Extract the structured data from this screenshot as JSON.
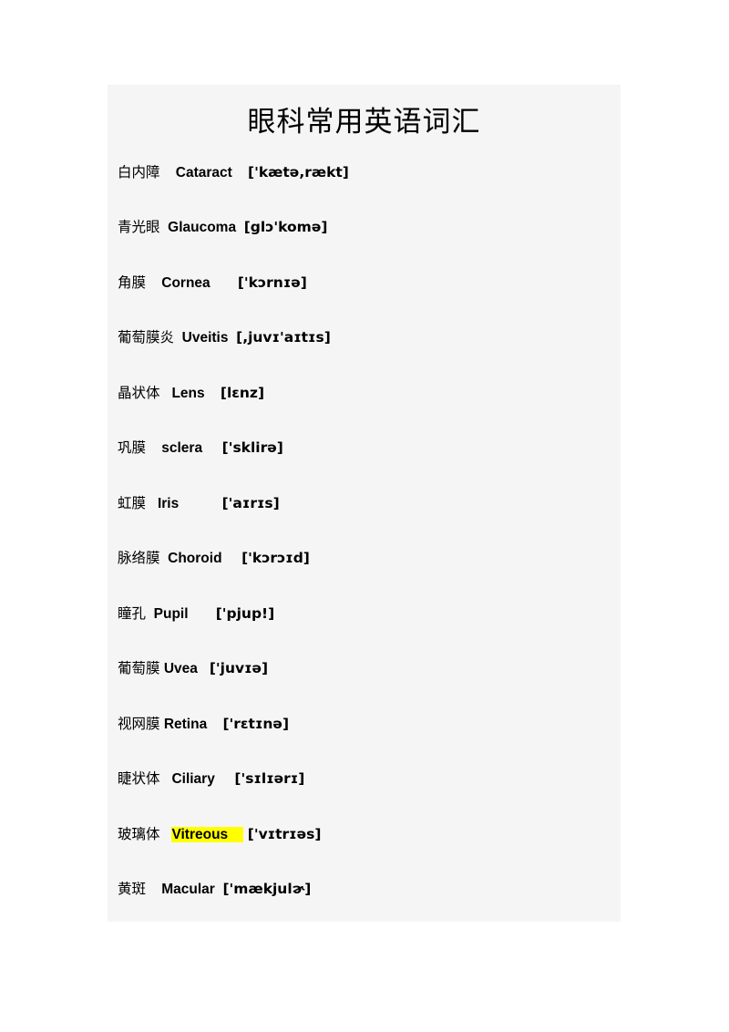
{
  "document": {
    "title": "眼科常用英语词汇",
    "background_color": "#f5f5f5",
    "page_color": "#ffffff",
    "highlight_color": "#ffff00",
    "text_color": "#000000"
  },
  "entries": [
    {
      "chinese": "白内障",
      "english": "Cataract",
      "ipa": "['kætə,rækt]",
      "highlighted": false,
      "gap1": "    ",
      "gap2": "    ",
      "highlight_pad": ""
    },
    {
      "chinese": "青光眼",
      "english": "Glaucoma",
      "ipa": "[glɔ'komə]",
      "highlighted": false,
      "gap1": "  ",
      "gap2": "  ",
      "highlight_pad": ""
    },
    {
      "chinese": "角膜",
      "english": "Cornea",
      "ipa": "['kɔrnɪə]",
      "highlighted": false,
      "gap1": "    ",
      "gap2": "       ",
      "highlight_pad": ""
    },
    {
      "chinese": "葡萄膜炎",
      "english": "Uveitis",
      "ipa": "[,juvɪ'aɪtɪs]",
      "highlighted": false,
      "gap1": "  ",
      "gap2": "  ",
      "highlight_pad": ""
    },
    {
      "chinese": "晶状体",
      "english": "Lens",
      "ipa": "[lɛnz]",
      "highlighted": false,
      "gap1": "   ",
      "gap2": "    ",
      "highlight_pad": ""
    },
    {
      "chinese": "巩膜",
      "english": "sclera",
      "ipa": "['sklirə]",
      "highlighted": false,
      "gap1": "    ",
      "gap2": "     ",
      "highlight_pad": ""
    },
    {
      "chinese": "虹膜",
      "english": "Iris",
      "ipa": "['aɪrɪs]",
      "highlighted": false,
      "gap1": "   ",
      "gap2": "           ",
      "highlight_pad": ""
    },
    {
      "chinese": "脉络膜",
      "english": "Choroid",
      "ipa": "['kɔrɔɪd]",
      "highlighted": false,
      "gap1": "  ",
      "gap2": "     ",
      "highlight_pad": ""
    },
    {
      "chinese": "瞳孔",
      "english": "Pupil",
      "ipa": "['pjup!]",
      "highlighted": false,
      "gap1": "  ",
      "gap2": "       ",
      "highlight_pad": ""
    },
    {
      "chinese": "葡萄膜",
      "english": "Uvea",
      "ipa": "['juvɪə]",
      "highlighted": false,
      "gap1": " ",
      "gap2": "   ",
      "highlight_pad": ""
    },
    {
      "chinese": "视网膜",
      "english": "Retina",
      "ipa": "['rɛtɪnə]",
      "highlighted": false,
      "gap1": " ",
      "gap2": "    ",
      "highlight_pad": ""
    },
    {
      "chinese": "睫状体",
      "english": "Ciliary",
      "ipa": "['sɪlɪərɪ]",
      "highlighted": false,
      "gap1": "   ",
      "gap2": "     ",
      "highlight_pad": ""
    },
    {
      "chinese": "玻璃体",
      "english": "Vitreous",
      "ipa": "['vɪtrɪəs]",
      "highlighted": true,
      "gap1": "   ",
      "gap2": " ",
      "highlight_pad": "    "
    },
    {
      "chinese": "黄斑",
      "english": "Macular",
      "ipa": "['mækjulɚ]",
      "highlighted": false,
      "gap1": "    ",
      "gap2": "  ",
      "highlight_pad": ""
    }
  ]
}
